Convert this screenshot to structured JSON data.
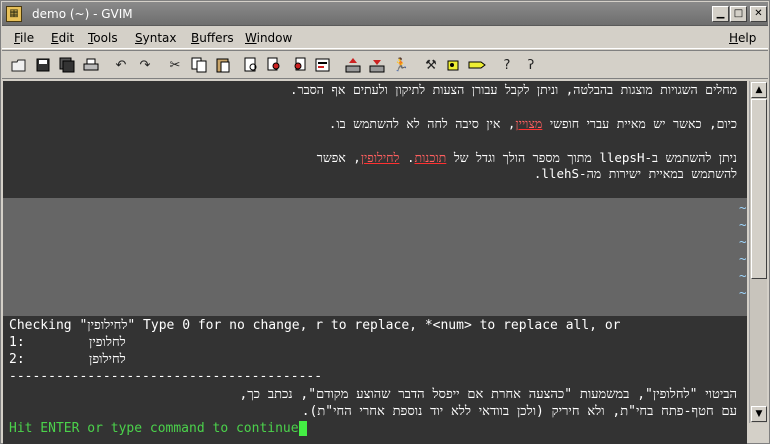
{
  "window": {
    "title": "demo (~) - GVIM",
    "icon_glyph": "▦"
  },
  "menu": [
    {
      "label": "File",
      "hotkey": "F"
    },
    {
      "label": "Edit",
      "hotkey": "E"
    },
    {
      "label": "Tools",
      "hotkey": "T"
    },
    {
      "label": "Syntax",
      "hotkey": "S"
    },
    {
      "label": "Buffers",
      "hotkey": "B"
    },
    {
      "label": "Window",
      "hotkey": "W"
    },
    {
      "label": "Help",
      "hotkey": "H"
    }
  ],
  "toolbar": [
    "open-icon",
    "save-icon",
    "save-all-icon",
    "print-icon",
    "undo-icon",
    "redo-icon",
    "cut-icon",
    "copy-icon",
    "paste-icon",
    "find-replace-icon",
    "find-next-icon",
    "find-prev-icon",
    "load-session-icon",
    "save-session-icon",
    "run-script-icon",
    "make-icon",
    "build-tags-icon",
    "jump-tag-icon",
    "help-icon",
    "find-help-icon"
  ],
  "editor": {
    "lines": [
      {
        "text": "מחלים השגויות מוצגות בהבלטה, וניתן לקבל עבורן הצעות לתיקון ולעתים אף הסבר."
      },
      {
        "parts": [
          "כיום, כאשר יש מאיית עברי חופשי ",
          "מצויין",
          ", אין סיבה לחה לא להשתמש בו."
        ]
      },
      {
        "parts": [
          "ניתן להשתמש ב-llepsH מתוך מספר הולך וגדל של ",
          "תוכנות",
          ". ",
          "לחילופין",
          ", אפשר"
        ]
      },
      {
        "text": "להשתמש במאיית ישירות מה-llehS."
      }
    ],
    "tilde": "~",
    "tilde_count": 6
  },
  "messages": {
    "checking": "Checking \"לחילופין\" Type 0 for no change, r to replace, *<num> to replace all, or",
    "option1_num": "1:",
    "option1_word": "לחלופין",
    "option2_num": "2:",
    "option2_word": "לחילופן",
    "separator": "----------------------------------------",
    "explain1": "הביטוי \"לחלופין\", במשמעות \"כהצעה אחרת אם ייפסל הדבר שהוצע מקודם\", נכתב כך,",
    "explain2": "עם חטף-פתח בחי\"ת, ולא חיריק (ולכן בוודאי ללא יוד נוספת אחרי החי\"ת).",
    "prompt": "Hit ENTER or type command to continue"
  },
  "colors": {
    "editor_bg": "#333333",
    "highlight_bg": "#666666",
    "spell_error": "#ff6060",
    "tilde": "#9fd7ff",
    "prompt": "#4bd24b"
  }
}
